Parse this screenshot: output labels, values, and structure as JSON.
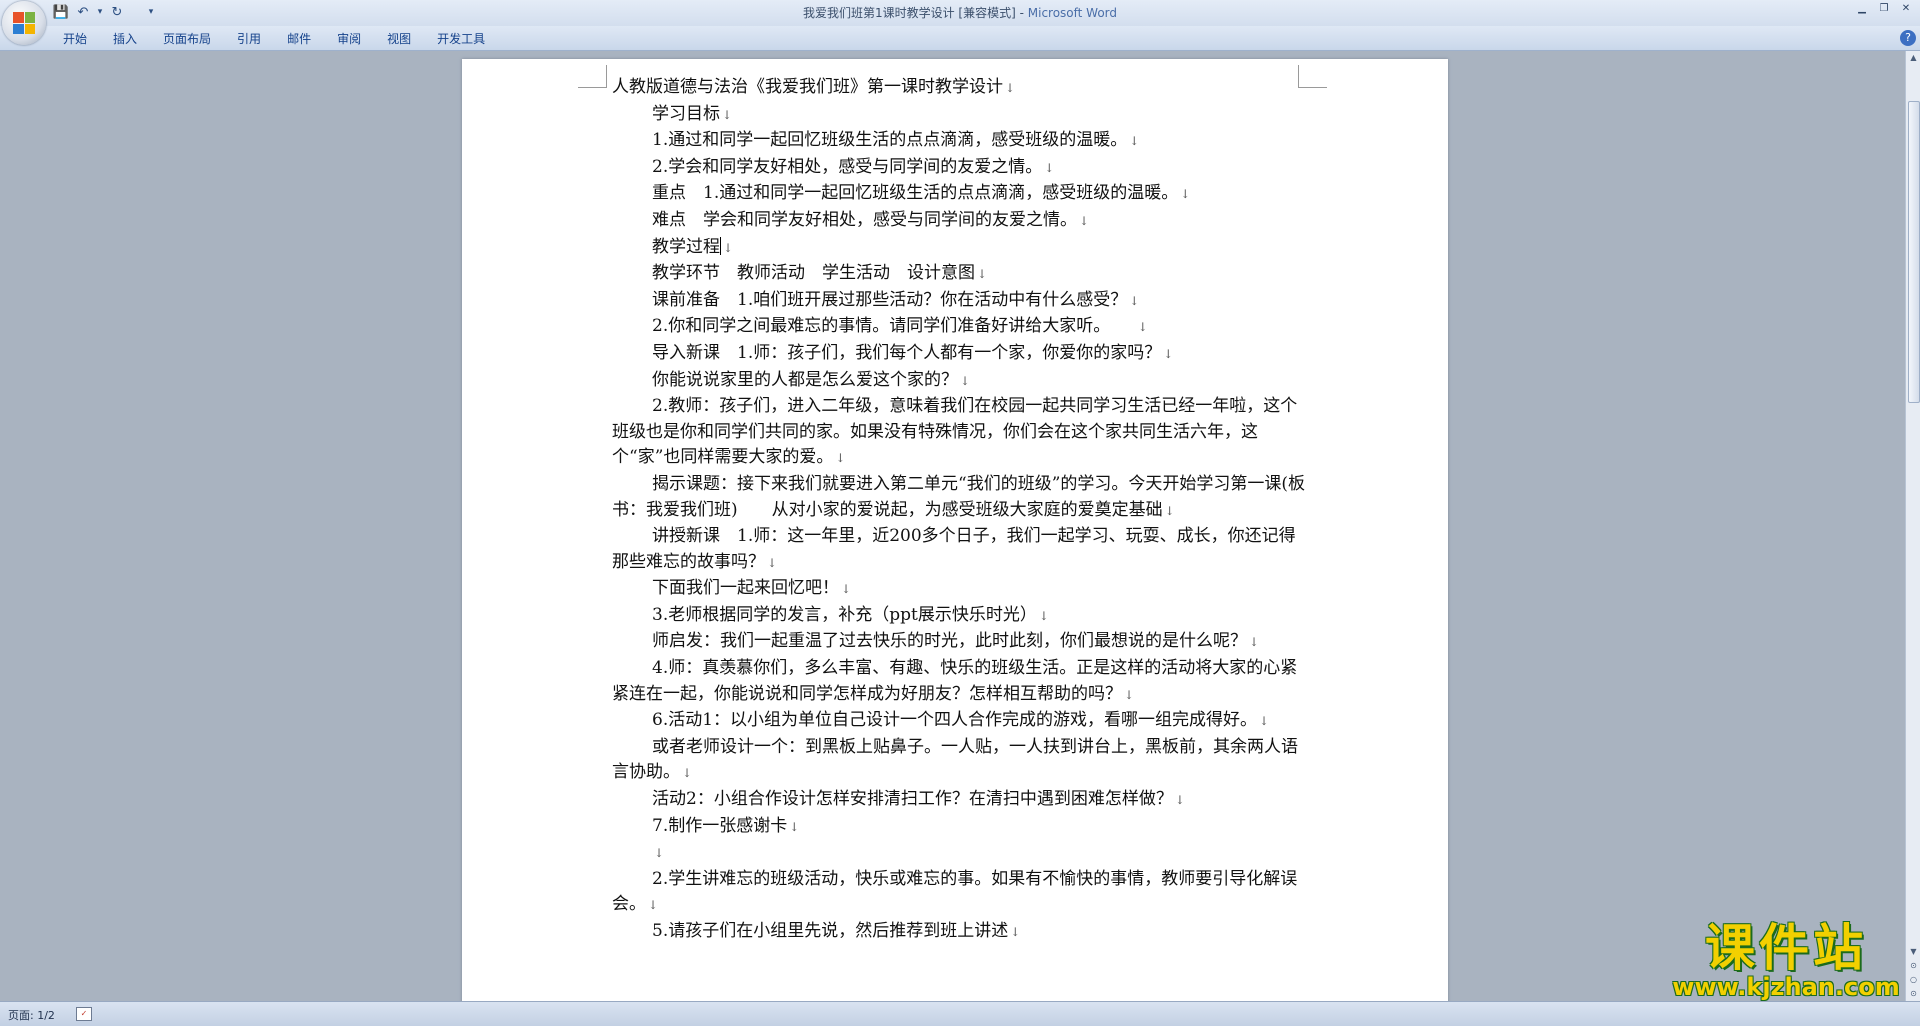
{
  "window": {
    "title": "我爱我们班第1课时教学设计 [兼容模式]",
    "title_sep": " - ",
    "app_name": "Microsoft Word",
    "minimize_glyph": "▁",
    "restore_glyph": "❐",
    "close_glyph": "✕"
  },
  "quick_access": {
    "save_icon": "💾",
    "undo_icon": "↶",
    "undo_dropdown": "▾",
    "redo_icon": "↻",
    "customize_icon": "▾"
  },
  "ribbon": {
    "tabs": [
      "开始",
      "插入",
      "页面布局",
      "引用",
      "邮件",
      "审阅",
      "视图",
      "开发工具"
    ],
    "help_glyph": "?"
  },
  "document": {
    "paragraphs": [
      {
        "text": "人教版道德与法治《我爱我们班》第一课时教学设计",
        "indent": false
      },
      {
        "text": "学习目标",
        "indent": true
      },
      {
        "text": "1.通过和同学一起回忆班级生活的点点滴滴，感受班级的温暖。",
        "indent": true
      },
      {
        "text": "2.学会和同学友好相处，感受与同学间的友爱之情。",
        "indent": true
      },
      {
        "text": "重点　1.通过和同学一起回忆班级生活的点点滴滴，感受班级的温暖。",
        "indent": true
      },
      {
        "text": "难点　学会和同学友好相处，感受与同学间的友爱之情。",
        "indent": true
      },
      {
        "text": "教学过程",
        "indent": true,
        "cursor": true
      },
      {
        "text": "教学环节　教师活动　学生活动　设计意图",
        "indent": true
      },
      {
        "text": "课前准备　1.咱们班开展过那些活动？你在活动中有什么感受？",
        "indent": true
      },
      {
        "text": "2.你和同学之间最难忘的事情。请同学们准备好讲给大家听。　　",
        "indent": true
      },
      {
        "text": "导入新课　1.师：孩子们，我们每个人都有一个家，你爱你的家吗？",
        "indent": true
      },
      {
        "text": "你能说说家里的人都是怎么爱这个家的？",
        "indent": true
      },
      {
        "text": "2.教师：孩子们，进入二年级，意味着我们在校园一起共同学习生活已经一年啦，这个班级也是你和同学们共同的家。如果没有特殊情况，你们会在这个家共同生活六年，这个“家”也同样需要大家的爱。",
        "indent": true
      },
      {
        "text": "揭示课题：接下来我们就要进入第二单元“我们的班级”的学习。今天开始学习第一课(板书：我爱我们班)　　从对小家的爱说起，为感受班级大家庭的爱奠定基础",
        "indent": true
      },
      {
        "text": "讲授新课　1.师：这一年里，近200多个日子，我们一起学习、玩耍、成长，你还记得那些难忘的故事吗？",
        "indent": true
      },
      {
        "text": "下面我们一起来回忆吧！",
        "indent": true
      },
      {
        "text": "3.老师根据同学的发言，补充（ppt展示快乐时光）",
        "indent": true
      },
      {
        "text": "师启发：我们一起重温了过去快乐的时光，此时此刻，你们最想说的是什么呢？",
        "indent": true
      },
      {
        "text": "4.师：真羡慕你们，多么丰富、有趣、快乐的班级生活。正是这样的活动将大家的心紧紧连在一起，你能说说和同学怎样成为好朋友？怎样相互帮助的吗？",
        "indent": true
      },
      {
        "text": "6.活动1：以小组为单位自己设计一个四人合作完成的游戏，看哪一组完成得好。",
        "indent": true
      },
      {
        "text": "或者老师设计一个：到黑板上贴鼻子。一人贴，一人扶到讲台上，黑板前，其余两人语言协助。",
        "indent": true
      },
      {
        "text": "活动2：小组合作设计怎样安排清扫工作？在清扫中遇到困难怎样做？",
        "indent": true
      },
      {
        "text": "7.制作一张感谢卡",
        "indent": true
      },
      {
        "text": "",
        "indent": true
      },
      {
        "text": "2.学生讲难忘的班级活动，快乐或难忘的事。如果有不愉快的事情，教师要引导化解误会。",
        "indent": true
      },
      {
        "text": "5.请孩子们在小组里先说，然后推荐到班上讲述",
        "indent": true
      }
    ],
    "paragraph_mark": "↓"
  },
  "scrollbar": {
    "up": "▲",
    "down": "▼",
    "prev_page": "⊙",
    "select_browse": "○",
    "next_page": "⊙"
  },
  "status": {
    "page_label": "页面: 1/2",
    "proof_icon": "✓"
  },
  "watermark": {
    "cn": "课件站",
    "url": "www.kjzhan.com"
  }
}
